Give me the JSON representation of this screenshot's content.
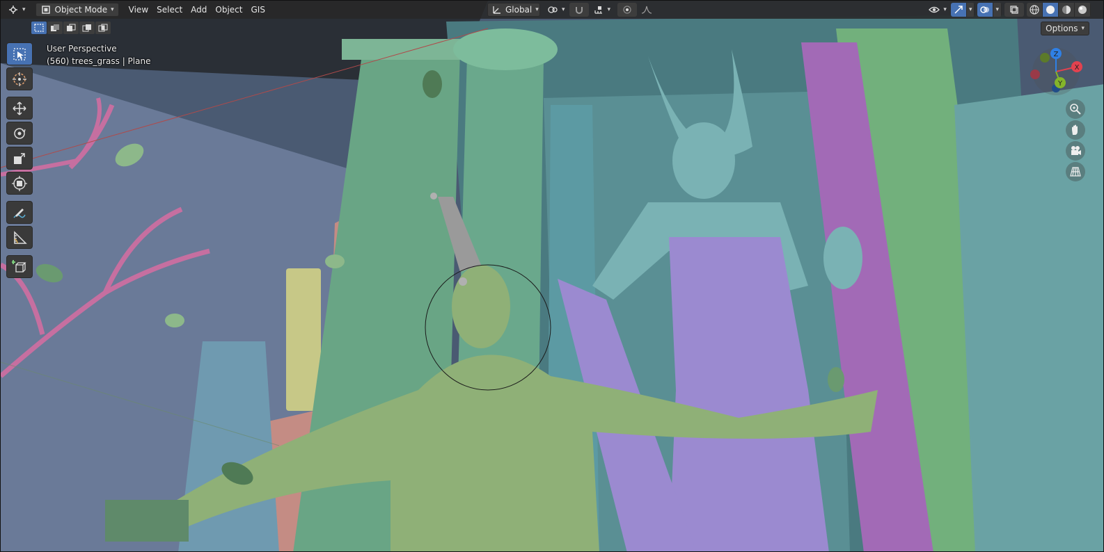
{
  "header": {
    "editor_type_icon": "editor-type-icon",
    "mode": {
      "label": "Object Mode",
      "icon": "object-mode-icon"
    },
    "menus": [
      "View",
      "Select",
      "Add",
      "Object",
      "GIS"
    ],
    "transform_orientation": {
      "label": "Global",
      "icon": "orientation-icon"
    },
    "pivot_icon": "pivot-point-icon",
    "snap_icon": "magnet-snap-icon",
    "snap_target_icon": "snap-increment-icon",
    "proportional_icon": "proportional-edit-icon",
    "falloff_icon": "falloff-curve-icon",
    "visibility_icon": "eye-visibility-icon",
    "gizmo_icon": "gizmo-toggle-icon",
    "overlay_icon": "overlay-icon",
    "xray_icon": "xray-icon",
    "shading_modes": [
      "wireframe",
      "solid",
      "material-preview",
      "rendered"
    ],
    "shading_active": "solid"
  },
  "subheader": {
    "selection_modes": [
      "set",
      "extend",
      "subtract",
      "invert",
      "intersect"
    ],
    "options_label": "Options"
  },
  "viewport": {
    "view_name": "User Perspective",
    "object_info": "(560) trees_grass | Plane"
  },
  "toolbar": {
    "tools": [
      "select-box",
      "cursor",
      "move",
      "rotate",
      "scale",
      "transform",
      "annotate",
      "measure",
      "add-cube"
    ],
    "active_tool": "select-box"
  },
  "nav_gizmo": {
    "axes": [
      "X",
      "Y",
      "Z"
    ],
    "axis_colors": {
      "x": "#e3424f",
      "y": "#84b52a",
      "z": "#2f80e6"
    },
    "buttons": [
      "zoom",
      "pan",
      "camera",
      "perspective-toggle"
    ]
  },
  "colors": {
    "header_bg": "#282828",
    "accent": "#4772b3",
    "button_bg": "#3d3d3d",
    "sky": "#5d6d8a",
    "column_green": "#5f9a78",
    "column_teal": "#6eaab0",
    "column_purple": "#a06ab0",
    "statue_teal": "#7ab2b4",
    "robe_purple": "#9b8ad0",
    "figure_green": "#8fb077",
    "branch_pink": "#c66fa0"
  }
}
